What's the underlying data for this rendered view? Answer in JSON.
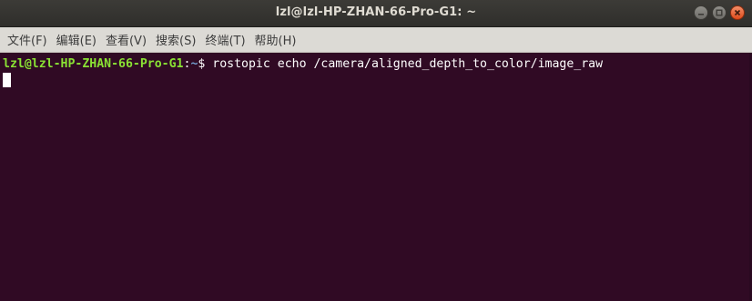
{
  "window": {
    "title": "lzl@lzl-HP-ZHAN-66-Pro-G1: ~"
  },
  "menu": {
    "items": [
      {
        "label": "文件(F)"
      },
      {
        "label": "编辑(E)"
      },
      {
        "label": "查看(V)"
      },
      {
        "label": "搜索(S)"
      },
      {
        "label": "终端(T)"
      },
      {
        "label": "帮助(H)"
      }
    ]
  },
  "terminal": {
    "prompt_user_host": "lzl@lzl-HP-ZHAN-66-Pro-G1",
    "prompt_colon": ":",
    "prompt_path": "~",
    "prompt_symbol": "$ ",
    "command": "rostopic echo /camera/aligned_depth_to_color/image_raw"
  },
  "colors": {
    "terminal_bg": "#300a24",
    "prompt_user": "#8ae234",
    "prompt_path": "#729fcf",
    "close_button": "#de4b1b"
  },
  "icons": {
    "minimize": "minimize-icon",
    "maximize": "maximize-icon",
    "close": "close-icon"
  }
}
